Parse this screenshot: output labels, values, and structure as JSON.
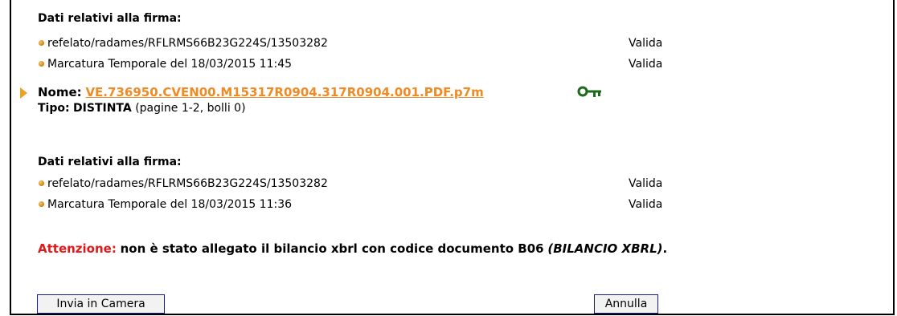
{
  "block1": {
    "header": "Dati relativi alla firma:",
    "rows": [
      {
        "label": "refelato/radames/RFLRMS66B23G224S/13503282",
        "status": "Valida"
      },
      {
        "label": "Marcatura Temporale del 18/03/2015 11:45",
        "status": "Valida"
      }
    ]
  },
  "file": {
    "name_label": "Nome:",
    "name": "VE.736950.CVEN00.M15317R0904.317R0904.001.PDF.p7m",
    "type_label": "Tipo:",
    "type_value": "DISTINTA",
    "type_detail": "(pagine 1-2, bolli 0)",
    "key_icon": "key-icon",
    "key_color": "#1a6b1a"
  },
  "block2": {
    "header": "Dati relativi alla firma:",
    "rows": [
      {
        "label": "refelato/radames/RFLRMS66B23G224S/13503282",
        "status": "Valida"
      },
      {
        "label": "Marcatura Temporale del 18/03/2015 11:36",
        "status": "Valida"
      }
    ]
  },
  "warning": {
    "label": "Attenzione:",
    "text": "non è stato allegato il bilancio xbrl con codice documento B06",
    "italic": "(BILANCIO XBRL)",
    "end": ".",
    "label_color": "#e01818"
  },
  "buttons": {
    "send": "Invia in Camera",
    "cancel": "Annulla"
  },
  "colors": {
    "accent": "#ef8a25",
    "button_border": "#1a1a8c"
  }
}
